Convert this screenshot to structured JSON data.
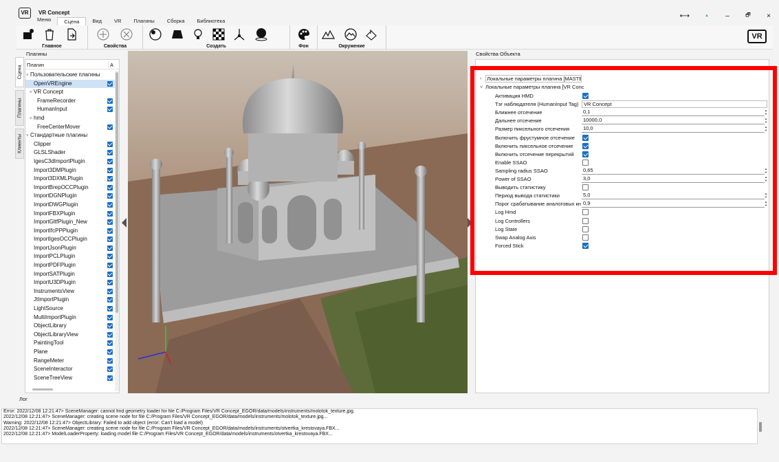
{
  "app": {
    "title": "VR Concept",
    "logo_text": "VR"
  },
  "window_controls": [
    "⟷",
    "▲",
    "–",
    "🗗",
    "×"
  ],
  "menu_tabs": [
    {
      "label": "Меню"
    },
    {
      "label": "Сцена"
    },
    {
      "label": "Вид"
    },
    {
      "label": "VR"
    },
    {
      "label": "Плагины"
    },
    {
      "label": "Сборка"
    },
    {
      "label": "Библиотека"
    }
  ],
  "ribbon": {
    "groups": [
      {
        "label": "Главное"
      },
      {
        "label": "Свойства"
      },
      {
        "label": "Создать"
      },
      {
        "label": "Фон"
      },
      {
        "label": "Окружение"
      }
    ]
  },
  "side_tabs": [
    "Сцена",
    "Плагины",
    "Клиенты"
  ],
  "plugins": {
    "header": "Плагины",
    "col_plugin": "Плагин",
    "col_active": "А",
    "items": [
      {
        "label": "Пользовательские плагины",
        "level": 0,
        "arrow": "˅",
        "check": false
      },
      {
        "label": "OpenVREngine",
        "level": 1,
        "arrow": "",
        "check": true,
        "selected": true
      },
      {
        "label": "VR Concept",
        "level": 1,
        "arrow": "˅",
        "check": false
      },
      {
        "label": "FrameRecorder",
        "level": 2,
        "arrow": "",
        "check": true
      },
      {
        "label": "HumanInput",
        "level": 2,
        "arrow": "",
        "check": true
      },
      {
        "label": "hmd",
        "level": 1,
        "arrow": "˅",
        "check": false
      },
      {
        "label": "FreeCenterMover",
        "level": 2,
        "arrow": "",
        "check": true
      },
      {
        "label": "Стандартные плагины",
        "level": 0,
        "arrow": "˅",
        "check": false
      },
      {
        "label": "Clipper",
        "level": 1,
        "arrow": "",
        "check": true
      },
      {
        "label": "GLSLShader",
        "level": 1,
        "arrow": "",
        "check": true
      },
      {
        "label": "IgesC3dImportPlugin",
        "level": 1,
        "arrow": "",
        "check": true
      },
      {
        "label": "Import3DMPlugin",
        "level": 1,
        "arrow": "",
        "check": true
      },
      {
        "label": "Import3DXMLPlugin",
        "level": 1,
        "arrow": "",
        "check": true
      },
      {
        "label": "ImportBrepOCCPlugin",
        "level": 1,
        "arrow": "",
        "check": true
      },
      {
        "label": "ImportDGNPlugin",
        "level": 1,
        "arrow": "",
        "check": true
      },
      {
        "label": "ImportDWGPlugin",
        "level": 1,
        "arrow": "",
        "check": true
      },
      {
        "label": "ImportFBXPlugin",
        "level": 1,
        "arrow": "",
        "check": true
      },
      {
        "label": "ImportGltfPlugin_New",
        "level": 1,
        "arrow": "",
        "check": true
      },
      {
        "label": "ImportIfcPPPlugin",
        "level": 1,
        "arrow": "",
        "check": true
      },
      {
        "label": "ImportIgesOCCPlugin",
        "level": 1,
        "arrow": "",
        "check": true
      },
      {
        "label": "ImportJsonPlugin",
        "level": 1,
        "arrow": "",
        "check": true
      },
      {
        "label": "ImportPCLPlugin",
        "level": 1,
        "arrow": "",
        "check": true
      },
      {
        "label": "ImportPDFPlugin",
        "level": 1,
        "arrow": "",
        "check": true
      },
      {
        "label": "ImportSATPlugin",
        "level": 1,
        "arrow": "",
        "check": true
      },
      {
        "label": "ImportU3DPlugin",
        "level": 1,
        "arrow": "",
        "check": true
      },
      {
        "label": "InstrumentsView",
        "level": 1,
        "arrow": "",
        "check": true
      },
      {
        "label": "JtImportPlugin",
        "level": 1,
        "arrow": "",
        "check": true
      },
      {
        "label": "LightSource",
        "level": 1,
        "arrow": "",
        "check": true
      },
      {
        "label": "MultiImportPlugin",
        "level": 1,
        "arrow": "",
        "check": true
      },
      {
        "label": "ObjectLibrary",
        "level": 1,
        "arrow": "",
        "check": true
      },
      {
        "label": "ObjectLibraryView",
        "level": 1,
        "arrow": "",
        "check": true
      },
      {
        "label": "PaintingTool",
        "level": 1,
        "arrow": "",
        "check": true
      },
      {
        "label": "Plane",
        "level": 1,
        "arrow": "",
        "check": true
      },
      {
        "label": "RangeMeter",
        "level": 1,
        "arrow": "",
        "check": true
      },
      {
        "label": "SceneInteractor",
        "level": 1,
        "arrow": "",
        "check": true
      },
      {
        "label": "SceneTreeView",
        "level": 1,
        "arrow": "",
        "check": true
      }
    ]
  },
  "properties": {
    "header": "Свойства Объекта",
    "section1": "Локальные параметры плагина [MASTER",
    "section2": "Локальные параметры плагина [VR Conc",
    "rows": [
      {
        "label": "Активация HMD",
        "type": "check",
        "checked": true
      },
      {
        "label": "Тэг наблюдателя (HumanInput Tag)",
        "type": "text",
        "value": "VR Concept"
      },
      {
        "label": "Ближнее отсечение",
        "type": "spin",
        "value": "0,1"
      },
      {
        "label": "Дальнее отсечение",
        "type": "spin",
        "value": "10000,0"
      },
      {
        "label": "Размер пиксельного отсечения",
        "type": "spin",
        "value": "10,0"
      },
      {
        "label": "Включить фрустумное отсечение",
        "type": "check",
        "checked": true
      },
      {
        "label": "Включить пиксельное отсечение",
        "type": "check",
        "checked": true
      },
      {
        "label": "Включить отсечение перекрытий",
        "type": "check",
        "checked": true
      },
      {
        "label": "Enable SSAO",
        "type": "check",
        "checked": false
      },
      {
        "label": "Sampling radius SSAO",
        "type": "spin",
        "value": "0,65"
      },
      {
        "label": "Power of SSAO",
        "type": "spin",
        "value": "3,0"
      },
      {
        "label": "Выводить статистику",
        "type": "check",
        "checked": false
      },
      {
        "label": "Период вывода статистики",
        "type": "spin",
        "value": "5,0"
      },
      {
        "label": "Порог срабатывание аналоговых кн",
        "type": "spin",
        "value": "0,9"
      },
      {
        "label": "Log Hmd",
        "type": "check",
        "checked": false
      },
      {
        "label": "Log Controllers",
        "type": "check",
        "checked": false
      },
      {
        "label": "Log State",
        "type": "check",
        "checked": false
      },
      {
        "label": "Swap Analog Axis",
        "type": "check",
        "checked": false
      },
      {
        "label": "Forced Stick",
        "type": "check",
        "checked": true
      }
    ]
  },
  "log": {
    "header": "Лог",
    "lines": [
      "Error: 2022/12/08 12:21:47> SceneManager: cannot find geometry loader for file C:/Program Files/VR Concept_EGOR/data/models/instruments/molotok_texture.jpg.",
      "2022/12/08 12:21:47> SceneManager: creating scene node for file C:/Program Files/VR Concept_EGOR/data/models/instruments/molotok_texture.jpg...",
      "Warning: 2022/12/08 12:21:47> ObjectLibrary: Failed to add object (error: Can't load a model)",
      "2022/12/08 12:21:47> SceneManager: creating scene node for file C:/Program Files/VR Concept_EGOR/data/models/instruments/otvertka_krestovaya.FBX...",
      "2022/12/08 12:21:47> ModelLoaderProperty: loading model file C:/Program Files/VR Concept_EGOR/data/models/instruments/otvertka_krestovaya.FBX..."
    ]
  },
  "colors": {
    "accent": "#1a6fc4",
    "highlight": "#ff0000",
    "selection": "#cfe2f5"
  }
}
